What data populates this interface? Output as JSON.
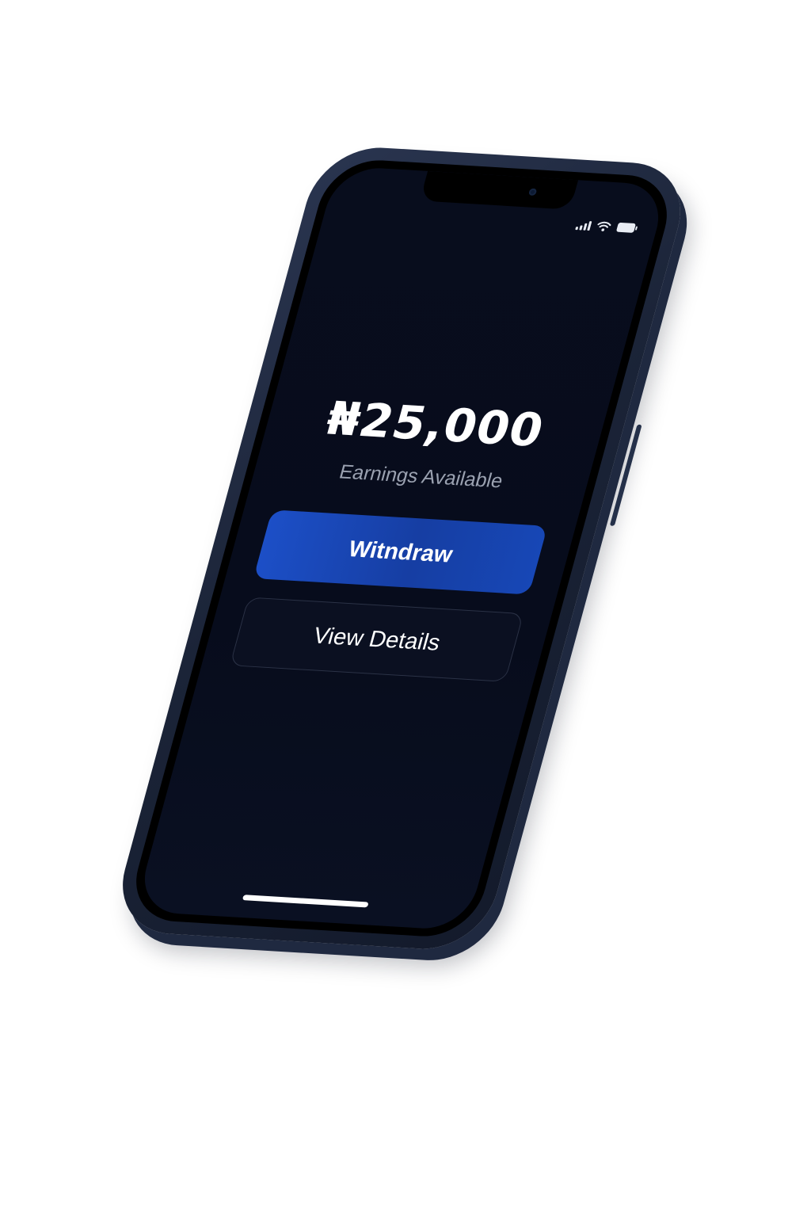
{
  "status_bar": {
    "signal_icon": "cellular-signal-icon",
    "wifi_icon": "wifi-icon",
    "battery_icon": "battery-icon"
  },
  "earnings": {
    "amount": "₦25,000",
    "label": "Earnings Available"
  },
  "actions": {
    "withdraw_label": "Witndraw",
    "details_label": "View Details"
  },
  "colors": {
    "screen_background": "#070c1c",
    "primary_button": "#1a48b8",
    "secondary_button_border": "#2b3246",
    "phone_frame": "#1b2438"
  }
}
